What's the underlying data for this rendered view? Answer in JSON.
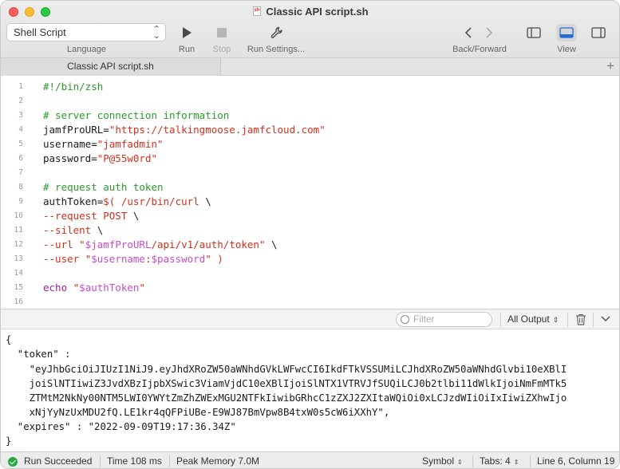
{
  "window": {
    "title": "Classic API script.sh"
  },
  "toolbar": {
    "language_value": "Shell Script",
    "language_label": "Language",
    "run_label": "Run",
    "stop_label": "Stop",
    "run_settings_label": "Run Settings...",
    "back_forward_label": "Back/Forward",
    "view_label": "View"
  },
  "tabs": [
    {
      "label": "Classic API script.sh"
    }
  ],
  "editor": {
    "line_numbers": [
      "1",
      "2",
      "3",
      "4",
      "5",
      "6",
      "7",
      "8",
      "9",
      "10",
      "11",
      "12",
      "13",
      "14",
      "15",
      "16"
    ],
    "lines": {
      "l1": "#!/bin/zsh",
      "l3": "# server connection information",
      "l4_a": "jamfProURL=",
      "l4_b": "\"https://talkingmoose.jamfcloud.com\"",
      "l5_a": "username=",
      "l5_b": "\"jamfadmin\"",
      "l6_a": "password=",
      "l6_b": "\"P@55w0rd\"",
      "l8": "# request auth token",
      "l9_a": "authToken=",
      "l9_b": "$( /usr/bin/curl ",
      "l9_c": "\\",
      "l10_a": "--request POST ",
      "l10_b": "\\",
      "l11_a": "--silent ",
      "l11_b": "\\",
      "l12_a": "--url ",
      "l12_b": "\"",
      "l12_c": "$jamfProURL",
      "l12_d": "/api/v1/auth/token\" ",
      "l12_e": "\\",
      "l13_a": "--user ",
      "l13_b": "\"",
      "l13_c": "$username",
      "l13_d": ":",
      "l13_e": "$password",
      "l13_f": "\" )",
      "l15_a": "echo ",
      "l15_b": "\"",
      "l15_c": "$authToken",
      "l15_d": "\""
    }
  },
  "console": {
    "filter_placeholder": "Filter",
    "output_select": "All Output",
    "output_lines": [
      "{",
      "  \"token\" :",
      "    \"eyJhbGciOiJIUzI1NiJ9.eyJhdXRoZW50aWNhdGVkLWFwcCI6IkdFTkVSSUMiLCJhdXRoZW50aWNhdGlvbi10eXBlI",
      "    joiSlNTIiwiZ3JvdXBzIjpbXSwic3ViamVjdC10eXBlIjoiSlNTX1VTRVJfSUQiLCJ0b2tlbi11dWlkIjoiNmFmMTk5",
      "    ZTMtM2NkNy00NTM5LWI0YWYtZmZhZWExMGU2NTFkIiwibGRhcC1zZXJ2ZXItaWQiOi0xLCJzdWIiOiIxIiwiZXhwIjo",
      "    xNjYyNzUxMDU2fQ.LE1kr4qQFPiUBe-E9WJ87BmVpw8B4txW0s5cW6iXXhY\",",
      "  \"expires\" : \"2022-09-09T19:17:36.34Z\"",
      "}"
    ]
  },
  "status": {
    "result": "Run Succeeded",
    "time": "Time 108 ms",
    "memory": "Peak Memory 7.0M",
    "symbol": "Symbol",
    "tabs": "Tabs: 4",
    "position": "Line 6, Column 19"
  },
  "colors": {
    "comment": "#2b9a2b",
    "string": "#d12f1b",
    "variable": "#c64bc7",
    "keyword": "#9b2393",
    "success": "#27a844",
    "accent": "#1f6fd1"
  }
}
